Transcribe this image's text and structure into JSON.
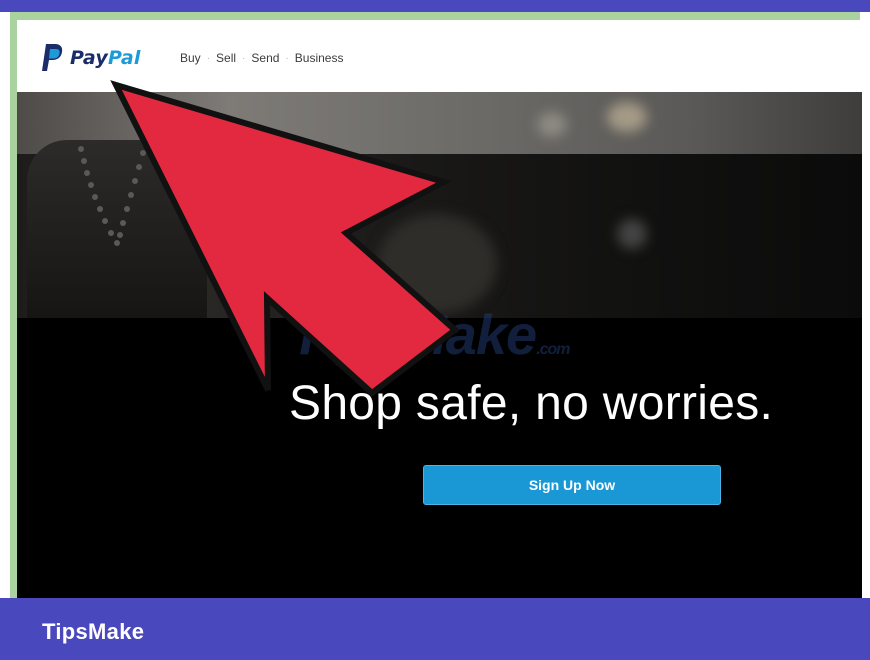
{
  "header": {
    "logo": {
      "pay": "Pay",
      "pal": "Pal"
    },
    "nav": [
      "Buy",
      "Sell",
      "Send",
      "Business"
    ],
    "nav_separator": "·"
  },
  "hero": {
    "tagline": "Shop safe, no worries.",
    "cta_label": "Sign Up Now"
  },
  "watermark": {
    "text": "TipsMake",
    "suffix": ".com"
  },
  "banner": {
    "text": "TipsMake"
  },
  "colors": {
    "brand_dark": "#1b2c6b",
    "brand_light": "#1e9bd7",
    "cta": "#1a98d5",
    "arrow": "#e2293f",
    "frame_blue": "#4a48bd",
    "frame_green": "#a9d29e"
  },
  "icons": {
    "logo_mark": "paypal-p-icon",
    "pointer": "red-arrow-icon"
  }
}
